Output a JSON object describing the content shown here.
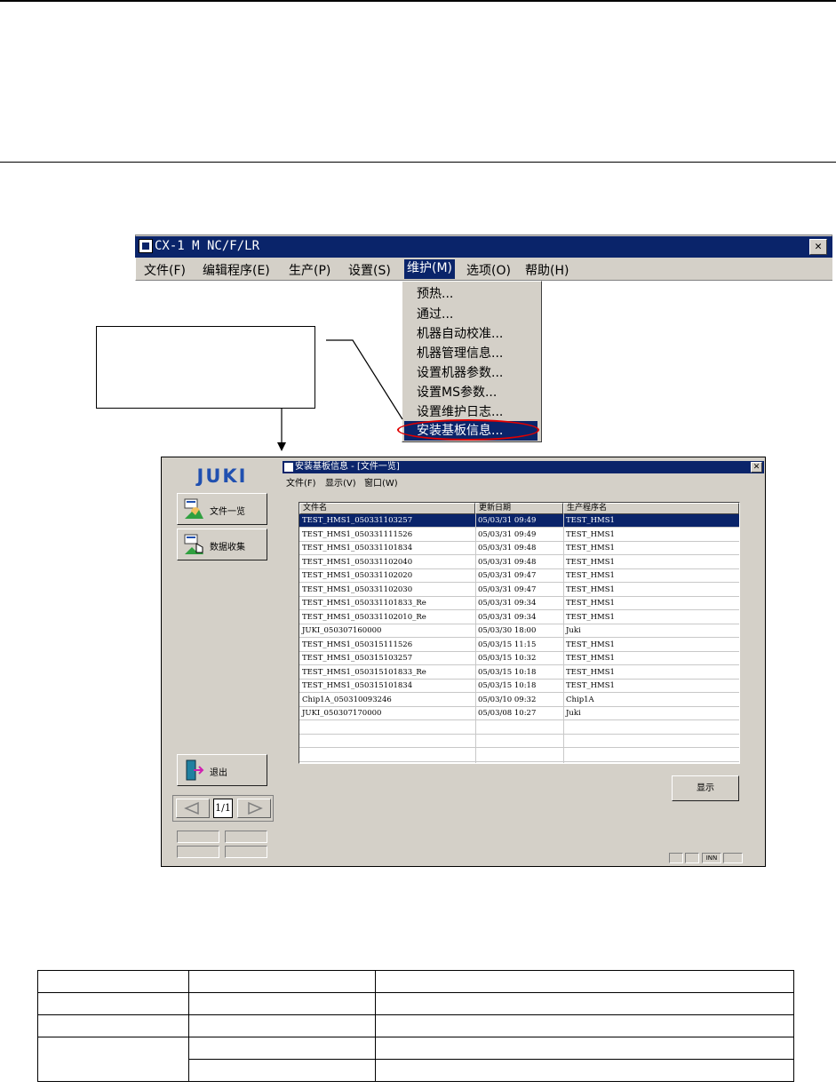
{
  "window": {
    "title": "CX-1 M NC/F/LR",
    "menu": [
      "文件(F)",
      "编辑程序(E)",
      "生产(P)",
      "设置(S)",
      "维护(M)",
      "选项(O)",
      "帮助(H)"
    ],
    "active_menu_index": 4
  },
  "maintenance_menu": {
    "items": [
      "预热...",
      "通过...",
      "机器自动校准...",
      "机器管理信息...",
      "设置机器参数...",
      "设置MS参数...",
      "设置维护日志...",
      "安装基板信息..."
    ],
    "selected_index": 7
  },
  "side_panel": {
    "logo": "JUKI",
    "buttons": [
      "文件一览",
      "数据收集"
    ],
    "exit_label": "退出",
    "page_indicator": "1/1"
  },
  "inner_window": {
    "title": "安装基板信息 - [文件一览]",
    "menu": [
      "文件(F)",
      "显示(V)",
      "窗口(W)"
    ],
    "columns": [
      "文件名",
      "更新日期",
      "生产程序名"
    ],
    "rows": [
      [
        "TEST_HMS1_050331103257",
        "05/03/31 09:49",
        "TEST_HMS1"
      ],
      [
        "TEST_HMS1_050331111526",
        "05/03/31 09:49",
        "TEST_HMS1"
      ],
      [
        "TEST_HMS1_050331101834",
        "05/03/31 09:48",
        "TEST_HMS1"
      ],
      [
        "TEST_HMS1_050331102040",
        "05/03/31 09:48",
        "TEST_HMS1"
      ],
      [
        "TEST_HMS1_050331102020",
        "05/03/31 09:47",
        "TEST_HMS1"
      ],
      [
        "TEST_HMS1_050331102030",
        "05/03/31 09:47",
        "TEST_HMS1"
      ],
      [
        "TEST_HMS1_050331101833_Re",
        "05/03/31 09:34",
        "TEST_HMS1"
      ],
      [
        "TEST_HMS1_050331102010_Re",
        "05/03/31 09:34",
        "TEST_HMS1"
      ],
      [
        "JUKI_050307160000",
        "05/03/30 18:00",
        "Juki"
      ],
      [
        "TEST_HMS1_050315111526",
        "05/03/15 11:15",
        "TEST_HMS1"
      ],
      [
        "TEST_HMS1_050315103257",
        "05/03/15 10:32",
        "TEST_HMS1"
      ],
      [
        "TEST_HMS1_050315101833_Re",
        "05/03/15 10:18",
        "TEST_HMS1"
      ],
      [
        "TEST_HMS1_050315101834",
        "05/03/15 10:18",
        "TEST_HMS1"
      ],
      [
        "Chip1A_050310093246",
        "05/03/10 09:32",
        "Chip1A"
      ],
      [
        "JUKI_050307170000",
        "05/03/08 10:27",
        "Juki"
      ]
    ],
    "selected_row": 0,
    "show_button": "显示",
    "status_text": "INN"
  },
  "colors": {
    "titlebar": "#0a246a",
    "highlight_oval": "#e00000",
    "window_face": "#d4d0c8"
  }
}
